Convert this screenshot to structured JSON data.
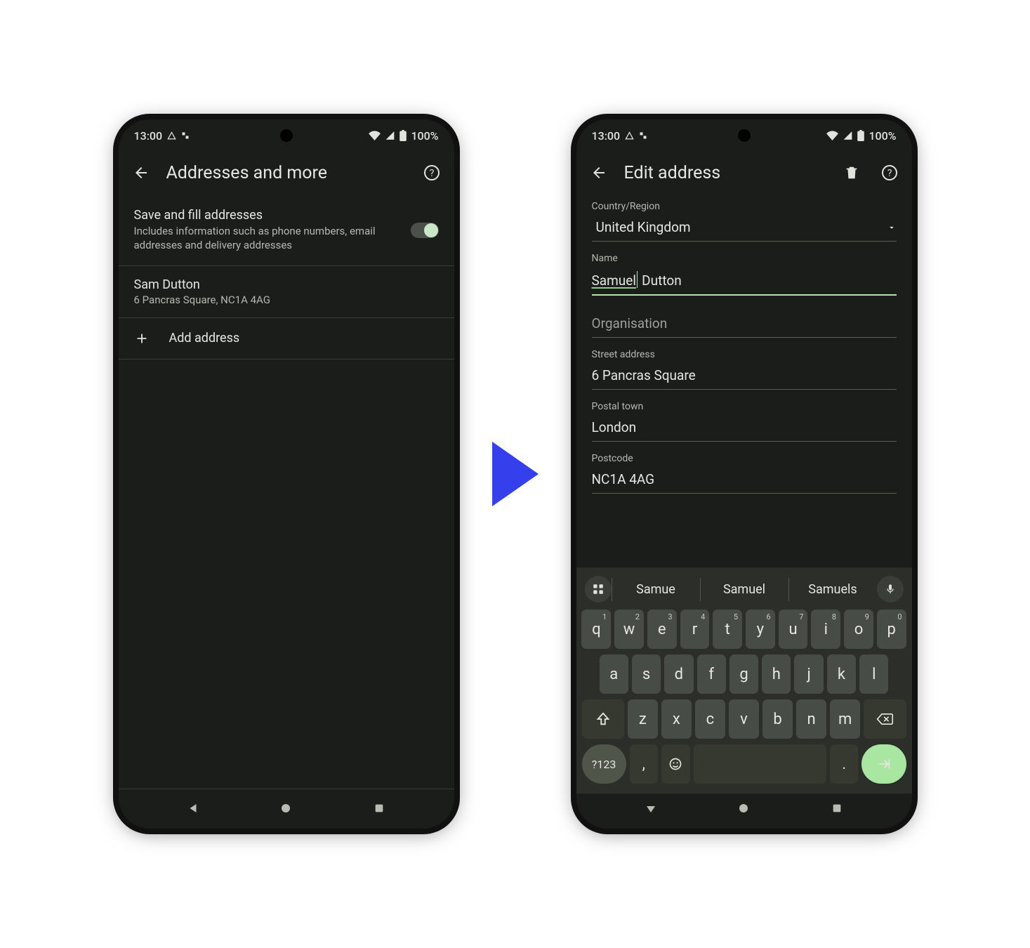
{
  "status": {
    "time": "13:00",
    "battery": "100%"
  },
  "left": {
    "title": "Addresses and more",
    "toggle": {
      "title": "Save and fill addresses",
      "subtitle": "Includes information such as phone numbers, email addresses and delivery addresses"
    },
    "address": {
      "name": "Sam Dutton",
      "line": "6 Pancras Square, NC1A 4AG"
    },
    "add_label": "Add address"
  },
  "right": {
    "title": "Edit address",
    "fields": {
      "country_label": "Country/Region",
      "country_value": "United Kingdom",
      "name_label": "Name",
      "name_first": "Samuel",
      "name_rest": " Dutton",
      "org_label": "Organisation",
      "street_label": "Street address",
      "street_value": "6 Pancras Square",
      "town_label": "Postal town",
      "town_value": "London",
      "postcode_label": "Postcode",
      "postcode_value": "NC1A 4AG"
    }
  },
  "keyboard": {
    "suggestions": [
      "Samue",
      "Samuel",
      "Samuels"
    ],
    "row1": [
      {
        "k": "q",
        "h": "1"
      },
      {
        "k": "w",
        "h": "2"
      },
      {
        "k": "e",
        "h": "3"
      },
      {
        "k": "r",
        "h": "4"
      },
      {
        "k": "t",
        "h": "5"
      },
      {
        "k": "y",
        "h": "6"
      },
      {
        "k": "u",
        "h": "7"
      },
      {
        "k": "i",
        "h": "8"
      },
      {
        "k": "o",
        "h": "9"
      },
      {
        "k": "p",
        "h": "0"
      }
    ],
    "row2": [
      "a",
      "s",
      "d",
      "f",
      "g",
      "h",
      "j",
      "k",
      "l"
    ],
    "row3": [
      "z",
      "x",
      "c",
      "v",
      "b",
      "n",
      "m"
    ],
    "mod123": "?123",
    "comma": ",",
    "period": "."
  }
}
